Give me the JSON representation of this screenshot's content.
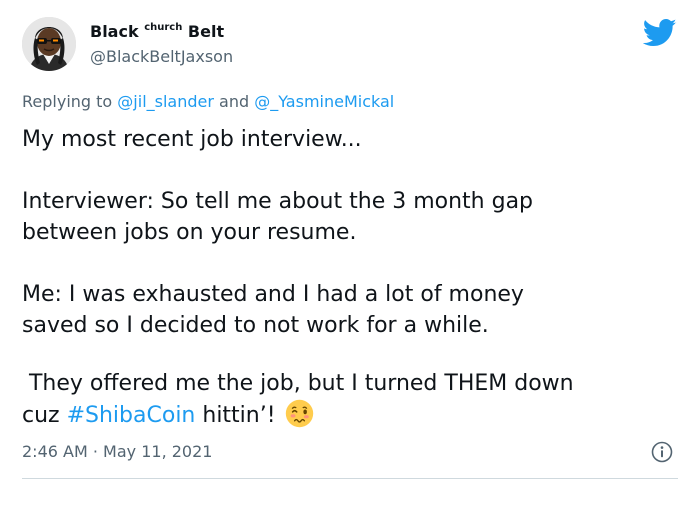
{
  "author": {
    "display_name_part1": "Black",
    "display_name_superscript": "church",
    "display_name_part2": "Belt",
    "handle": "@BlackBeltJaxson"
  },
  "reply": {
    "prefix": "Replying to",
    "mention1": "@jil_slander",
    "joiner": "and",
    "mention2": "@_YasmineMickal"
  },
  "tweet": {
    "paragraph1": "My most recent job interview...",
    "paragraph2_line1": "Interviewer: So tell me about the 3 month gap",
    "paragraph2_line2": "between jobs on your resume.",
    "paragraph3_line1": "Me: I was exhausted and I had a lot of money",
    "paragraph3_line2": "saved so I decided to not work for a while.",
    "paragraph4_line1": " They offered me the job, but I turned THEM down",
    "paragraph4_line2_prefix": "cuz",
    "hashtag": "#ShibaCoin",
    "paragraph4_line2_suffix": "hittin’!",
    "emoji": "woozy-face-emoji"
  },
  "meta": {
    "time": "2:46 AM",
    "separator": "·",
    "date": "May 11, 2021"
  },
  "icons": {
    "brand": "twitter-bird-icon",
    "info": "info-icon"
  },
  "colors": {
    "accent": "#1d9bf0",
    "secondary_text": "#536471",
    "primary_text": "#0f1419",
    "divider": "#cfd9de"
  }
}
